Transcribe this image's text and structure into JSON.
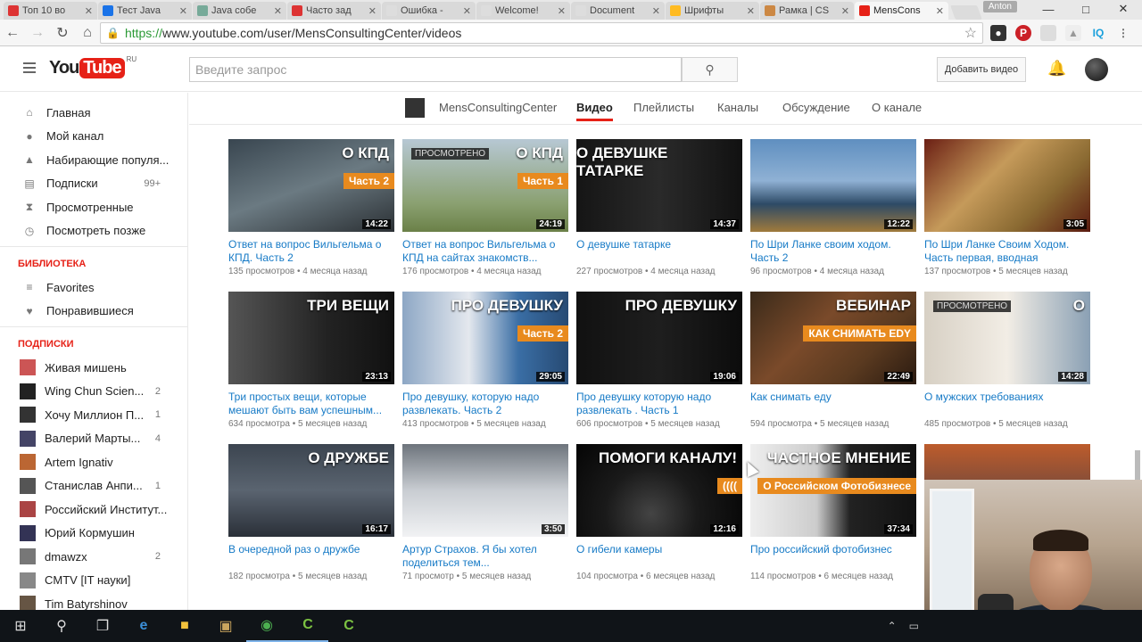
{
  "browser": {
    "tabs": [
      {
        "label": "Топ 10 во",
        "fav_color": "#d33"
      },
      {
        "label": "Тест Java",
        "fav_color": "#1a73e8"
      },
      {
        "label": "Java собе",
        "fav_color": "#7a9"
      },
      {
        "label": "Часто зад",
        "fav_color": "#d33"
      },
      {
        "label": "Ошибка -",
        "fav_color": "#ddd"
      },
      {
        "label": "Welcome!",
        "fav_color": "#ddd"
      },
      {
        "label": "Document",
        "fav_color": "#ddd"
      },
      {
        "label": "Шрифты",
        "fav_color": "#fb2"
      },
      {
        "label": "Рамка | CS",
        "fav_color": "#c84"
      },
      {
        "label": "MensCons",
        "fav_color": "#e62117",
        "active": true
      }
    ],
    "user_chip": "Anton",
    "url_https": "https://",
    "url_rest": "www.youtube.com/user/MensConsultingCenter/videos"
  },
  "header": {
    "logo_you": "You",
    "logo_tube": "Tube",
    "logo_region": "RU",
    "search_placeholder": "Введите запрос",
    "upload_label": "Добавить видео"
  },
  "sidebar": {
    "main_items": [
      {
        "label": "Главная",
        "icon": "home-icon",
        "glyph": "⌂"
      },
      {
        "label": "Мой канал",
        "icon": "user-icon",
        "glyph": "●"
      },
      {
        "label": "Набирающие популя...",
        "icon": "flame-icon",
        "glyph": "▲"
      },
      {
        "label": "Подписки",
        "icon": "subscriptions-icon",
        "glyph": "▤",
        "count": "99+"
      },
      {
        "label": "Просмотренные",
        "icon": "history-icon",
        "glyph": "⧗"
      },
      {
        "label": "Посмотреть позже",
        "icon": "clock-icon",
        "glyph": "◷"
      }
    ],
    "library_heading": "БИБЛИОТЕКА",
    "library_items": [
      {
        "label": "Favorites",
        "icon": "list-icon",
        "glyph": "≡"
      },
      {
        "label": "Понравившиеся",
        "icon": "thumbs-up-icon",
        "glyph": "♥"
      }
    ],
    "subs_heading": "ПОДПИСКИ",
    "subscriptions": [
      {
        "label": "Живая мишень",
        "color": "#c55"
      },
      {
        "label": "Wing Chun Scien...",
        "color": "#222",
        "count": "2"
      },
      {
        "label": "Хочу Миллион П...",
        "color": "#333",
        "count": "1"
      },
      {
        "label": "Валерий Марты...",
        "color": "#446",
        "count": "4"
      },
      {
        "label": "Artem Ignativ",
        "color": "#b63"
      },
      {
        "label": "Станислав Анпи...",
        "color": "#555",
        "count": "1"
      },
      {
        "label": "Российский Институт...",
        "color": "#a44"
      },
      {
        "label": "Юрий Кормушин",
        "color": "#335"
      },
      {
        "label": "dmawzx",
        "color": "#777",
        "count": "2"
      },
      {
        "label": "CMTV [IT науки]",
        "color": "#888"
      },
      {
        "label": "Tim Batyrshinov",
        "color": "#654"
      }
    ]
  },
  "channel": {
    "name": "MensConsultingCenter",
    "tabs": [
      "Видео",
      "Плейлисты",
      "Каналы",
      "Обсуждение",
      "О канале"
    ]
  },
  "videos": [
    {
      "title": "Ответ на вопрос Вильгельма о КПД. Часть 2",
      "meta": "135 просмотров • 4 месяца назад",
      "duration": "14:22",
      "overlay": "О КПД",
      "banner": "Часть 2",
      "bg": "linear-gradient(160deg,#394650,#6b7a82 50%,#2b3034)"
    },
    {
      "title": "Ответ на вопрос Вильгельма о КПД на сайтах знакомств...",
      "meta": "176 просмотров • 4 месяца назад",
      "duration": "24:19",
      "overlay": "О КПД",
      "banner": "Часть 1",
      "watched": "ПРОСМОТРЕНО",
      "bg": "linear-gradient(180deg,#b7c8d4,#8aa070 70%,#6b8048)"
    },
    {
      "title": "О девушке татарке",
      "meta": "227 просмотров • 4 месяца назад",
      "duration": "14:37",
      "overlay": "О ДЕВУШКЕ ТАТАРКЕ",
      "bg": "linear-gradient(90deg,#151515,#2a2a2a 50%,#111)"
    },
    {
      "title": "По Шри Ланке своим ходом. Часть 2",
      "meta": "96 просмотров • 4 месяца назад",
      "duration": "12:22",
      "bg": "linear-gradient(180deg,#5f8fc0,#8fb1d4 45%,#2d4a66 70%,#a07a3c)"
    },
    {
      "title": "По Шри Ланке Своим Ходом. Часть первая, вводная",
      "meta": "137 просмотров • 5 месяцев назад",
      "duration": "3:05",
      "bg": "linear-gradient(135deg,#6b1f14,#c59a5a 40%,#8a6a32 70%,#5a1a10)"
    },
    {
      "title": "Три простых вещи, которые мешают быть вам успешным...",
      "meta": "634 просмотра • 5 месяцев назад",
      "duration": "23:13",
      "overlay": "ТРИ ВЕЩИ",
      "bg": "linear-gradient(90deg,#555,#222 60%,#111)"
    },
    {
      "title": "Про девушку, которую надо развлекать. Часть 2",
      "meta": "413 просмотров • 5 месяцев назад",
      "duration": "29:05",
      "overlay": "ПРО ДЕВУШКУ",
      "banner": "Часть 2",
      "bg": "linear-gradient(90deg,#8da7c5,#e4e8ee 40%,#3a6ea5 70%,#274a73)"
    },
    {
      "title": "Про девушку которую надо развлекать . Часть 1",
      "meta": "606 просмотров • 5 месяцев назад",
      "duration": "19:06",
      "overlay": "ПРО ДЕВУШКУ",
      "bg": "linear-gradient(90deg,#111,#1e1e1e 50%,#0c0c0c)"
    },
    {
      "title": "Как снимать еду",
      "meta": "594 просмотра • 5 месяцев назад",
      "duration": "22:49",
      "overlay": "ВЕБИНАР",
      "banner": "КАК СНИМАТЬ EDY",
      "bg": "linear-gradient(135deg,#3a2a1a,#7a4a2a 40%,#5a3a20 70%,#2a1a10)"
    },
    {
      "title": "О мужских требованиях",
      "meta": "485 просмотров • 5 месяцев назад",
      "duration": "14:28",
      "overlay": "О",
      "watched": "ПРОСМОТРЕНО",
      "bg": "linear-gradient(90deg,#d7d0c4,#f2ede5 50%,#8aa0b4)"
    },
    {
      "title": "В очередной раз о дружбе",
      "meta": "182 просмотра • 5 месяцев назад",
      "duration": "16:17",
      "overlay": "О ДРУЖБЕ",
      "bg": "linear-gradient(180deg,#3c4550,#5a6470 50%,#2a3038)"
    },
    {
      "title": "Артур Страхов. Я бы хотел поделиться тем...",
      "meta": "71 просмотр • 5 месяцев назад",
      "duration": "3:50",
      "bg": "linear-gradient(180deg,#6d747c,#c9cdd2 50%,#f1f2f4)"
    },
    {
      "title": "О гибели камеры",
      "meta": "104 просмотра • 6 месяцев назад",
      "duration": "12:16",
      "overlay": "ПОМОГИ КАНАЛУ!",
      "banner": "((((",
      "bg": "radial-gradient(circle at 45% 75%,#444,#1a1a1a 40%,#000)"
    },
    {
      "title": "Про российский фотобизнес",
      "meta": "114 просмотров • 6 месяцев назад",
      "duration": "37:34",
      "overlay": "ЧАСТНОЕ МНЕНИЕ",
      "banner": "О Российском Фотобизнесе",
      "bg": "linear-gradient(90deg,#eee,#ccc 40%,#222 60%,#111)"
    },
    {
      "title": "",
      "meta": "",
      "duration": "",
      "bg": "linear-gradient(180deg,#bd5c2c,#3a3a48)"
    }
  ],
  "taskbar": {
    "icons": [
      "windows-start-icon",
      "search-icon",
      "task-view-icon",
      "edge-icon",
      "explorer-icon",
      "app-icon",
      "chrome-icon",
      "camtasia-icon",
      "camtasia2-icon"
    ]
  }
}
